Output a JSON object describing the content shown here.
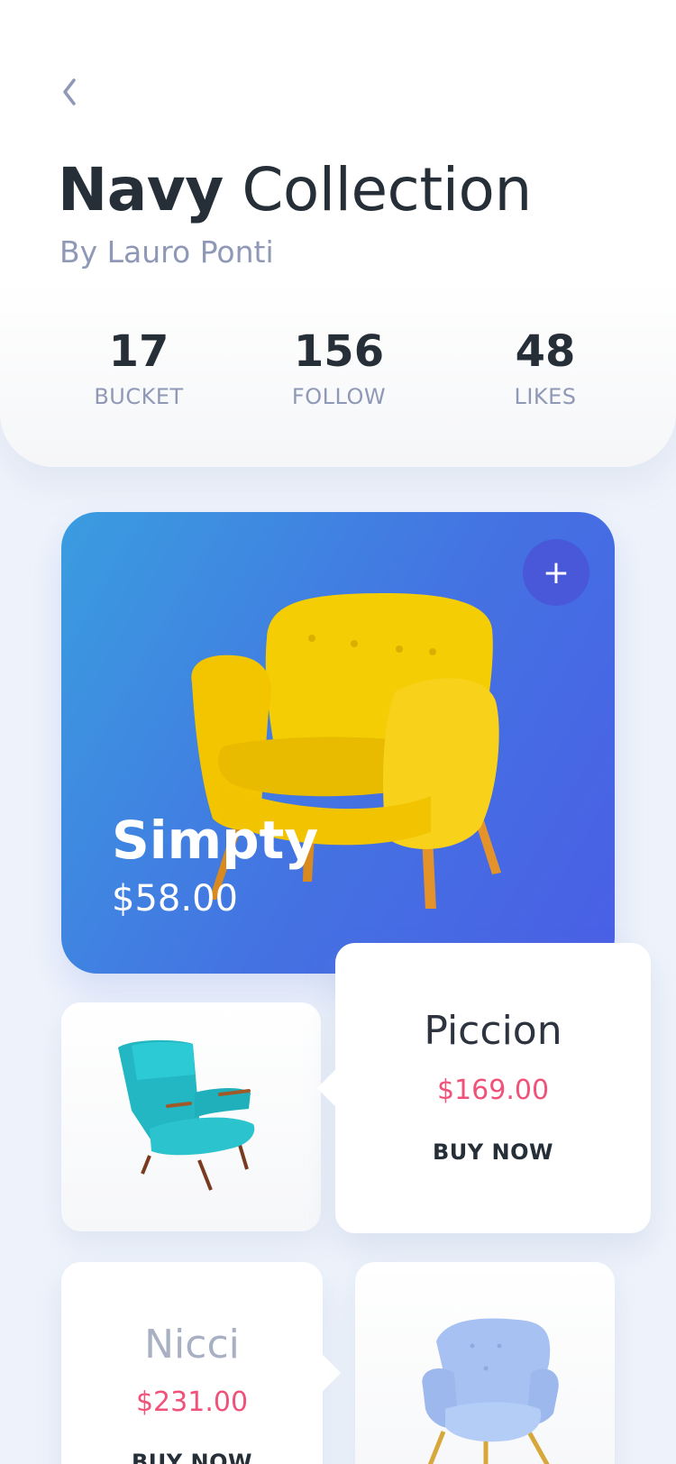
{
  "header": {
    "title_bold": "Navy",
    "title_rest": "Collection",
    "subtitle": "By Lauro Ponti",
    "stats": [
      {
        "value": "17",
        "label": "BUCKET"
      },
      {
        "value": "156",
        "label": "FOLLOW"
      },
      {
        "value": "48",
        "label": "LIKES"
      }
    ]
  },
  "featured": {
    "name": "Simpty",
    "price": "$58.00",
    "add_symbol": "+",
    "card_gradient": [
      "#3a9de0",
      "#4a5fe6"
    ],
    "chair_color": "#f5cd05"
  },
  "products": [
    {
      "name": "Piccion",
      "price": "$169.00",
      "action": "BUY NOW",
      "chair_color": "#25c2cc"
    },
    {
      "name": "Nicci",
      "price": "$231.00",
      "action": "BUY NOW",
      "chair_color": "#a7c1f2"
    }
  ],
  "colors": {
    "accent_price": "#f0527a",
    "text_dark": "#262f38",
    "text_muted": "#8f98b6",
    "background": "#eef3fb"
  },
  "icons": {
    "back": "chevron-left-icon",
    "add": "plus-icon"
  }
}
